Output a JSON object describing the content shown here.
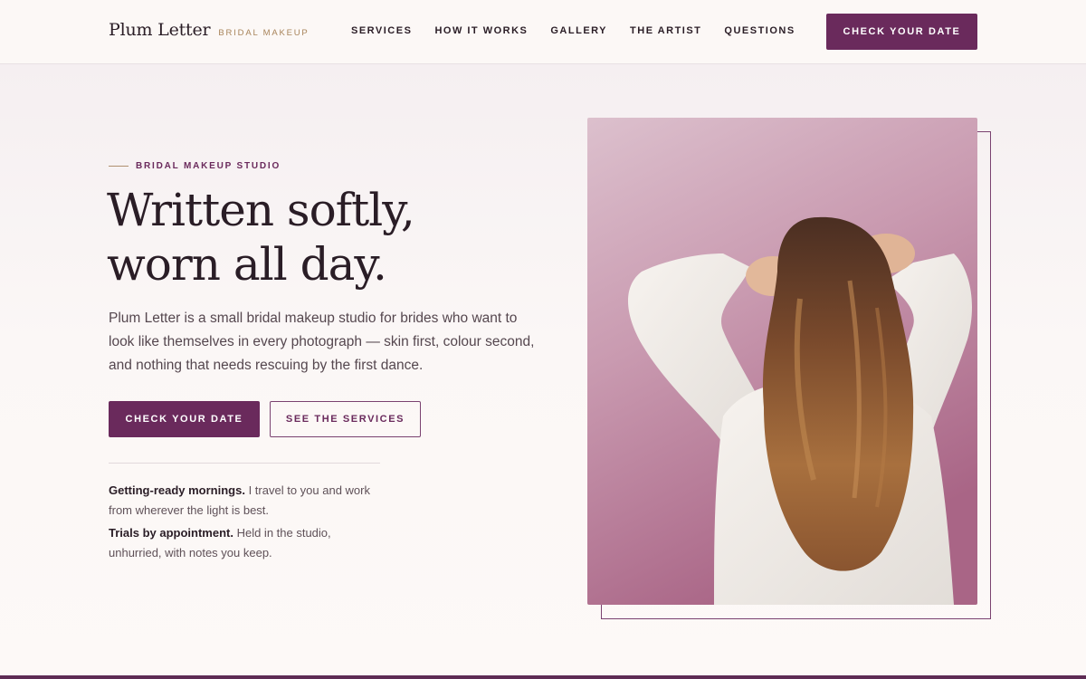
{
  "brand": {
    "name": "Plum Letter",
    "tagline": "BRIDAL MAKEUP"
  },
  "nav": {
    "items": [
      {
        "label": "SERVICES"
      },
      {
        "label": "HOW IT WORKS"
      },
      {
        "label": "GALLERY"
      },
      {
        "label": "THE ARTIST"
      },
      {
        "label": "QUESTIONS"
      }
    ],
    "cta_label": "CHECK YOUR DATE"
  },
  "hero": {
    "eyebrow": "BRIDAL MAKEUP STUDIO",
    "headline_line1": "Written softly,",
    "headline_line2": "worn all day.",
    "intro": "Plum Letter is a small bridal makeup studio for brides who want to look like themselves in every photograph — skin first, colour second, and nothing that needs rescuing by the first dance.",
    "primary_cta": "CHECK YOUR DATE",
    "secondary_cta": "SEE THE SERVICES",
    "notes": [
      {
        "title": "Getting-ready mornings.",
        "text": " I travel to you and work from wherever the light is best."
      },
      {
        "title": "Trials by appointment.",
        "text": " Held in the studio, unhurried, with notes you keep."
      }
    ]
  },
  "colors": {
    "accent": "#6a2a5c",
    "gold": "#a8845a",
    "background": "#fcf8f6"
  }
}
